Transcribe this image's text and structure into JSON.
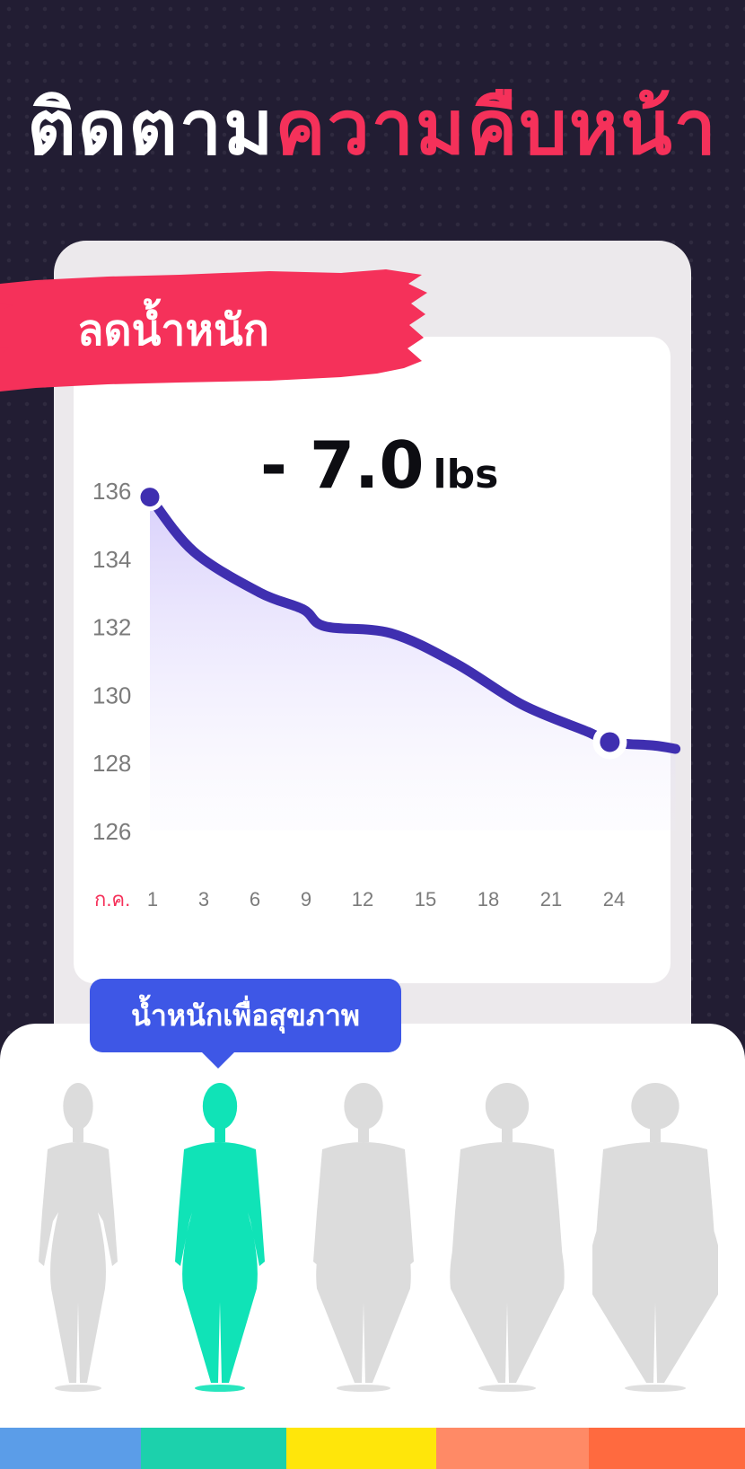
{
  "headline": {
    "part1": "ติดตาม",
    "part2": "ความคืบหน้า"
  },
  "colors": {
    "accent_red": "#f5315a",
    "line": "#3f2fb0",
    "selected_figure": "#10e3b7",
    "tooltip": "#3e57e6",
    "figure_gray": "#dcdcdc"
  },
  "banner": {
    "label": "ลดน้ำหนัก"
  },
  "summary": {
    "change": "- 7.0",
    "unit": "lbs"
  },
  "chart_data": {
    "type": "area",
    "x_prefix_label": "ก.ค.",
    "x": [
      1,
      3,
      6,
      9,
      12,
      15,
      18,
      21,
      24
    ],
    "y_ticks": [
      136,
      134,
      132,
      130,
      128,
      126
    ],
    "ylim": [
      126,
      136
    ],
    "series": [
      {
        "x": [
          1,
          3,
          6,
          8,
          9,
          12,
          15,
          18,
          21,
          22,
          24,
          25
        ],
        "values": [
          135.8,
          134.2,
          133.0,
          132.5,
          132.0,
          131.8,
          130.9,
          129.7,
          128.9,
          128.6,
          128.5,
          128.4
        ]
      }
    ],
    "markers": [
      {
        "x": 1,
        "y": 135.8
      },
      {
        "x": 22,
        "y": 128.6
      }
    ]
  },
  "body_types": {
    "tooltip": "น้ำหนักเพื่อสุขภาพ",
    "selected_index": 1,
    "count": 5
  },
  "color_strip": [
    "#5b9de8",
    "#1cd1ac",
    "#ffe60a",
    "#ff8a66",
    "#ff6a3f"
  ]
}
